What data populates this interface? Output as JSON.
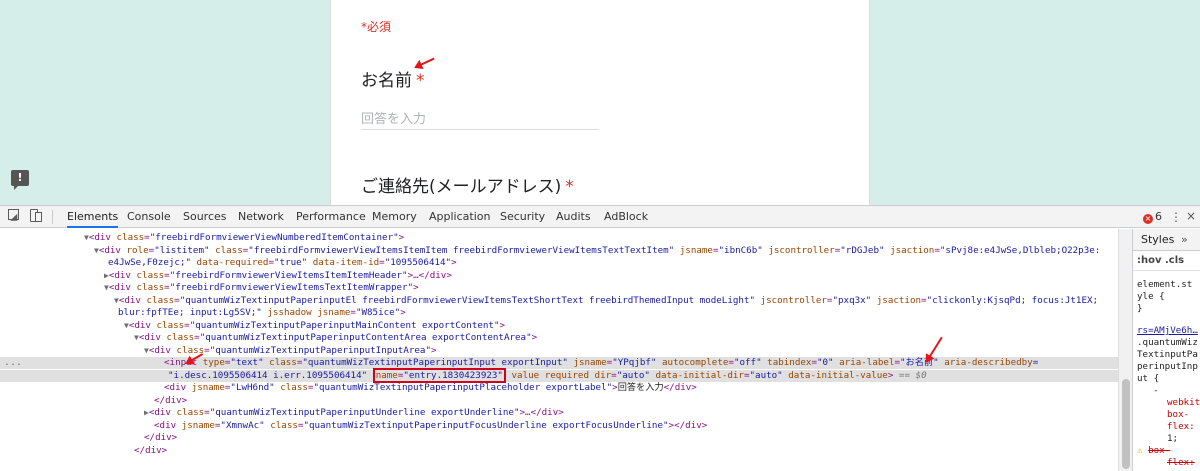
{
  "form": {
    "required_note": "*必須",
    "question1_title": "お名前",
    "question1_star": "*",
    "question1_placeholder": "回答を入力",
    "question2_title": "ご連絡先(メールアドレス)",
    "question2_star": "*",
    "feedback_icon_label": "!"
  },
  "devtools": {
    "tabs": [
      "Elements",
      "Console",
      "Sources",
      "Network",
      "Performance",
      "Memory",
      "Application",
      "Security",
      "Audits",
      "AdBlock"
    ],
    "active_tab": "Elements",
    "error_count": "6",
    "error_icon_label": "×",
    "more_label": "⋮",
    "close_label": "×",
    "dots_label": "...",
    "styles_title": "Styles",
    "styles_chevron": "»",
    "filter_label": ":hov .cls",
    "styles_lines": [
      "element.st",
      "yle {",
      "}",
      "rs=AMjVe6h…",
      ".quantumWiz",
      "TextinputPa",
      "perinputInp",
      "ut {",
      "-",
      "webkit-",
      "box-",
      "flex:",
      "1;",
      "box-",
      "flex:"
    ],
    "dom": {
      "l1": {
        "tag_open": "<div ",
        "a1n": "class",
        "a1v": "\"freebirdFormviewerViewNumberedItemContainer\"",
        "end": ">"
      },
      "l2": {
        "tag_open": "<div ",
        "a1n": "role",
        "a1v": "\"listitem\"",
        "a2n": "class",
        "a2v": "\"freebirdFormviewerViewItemsItemItem freebirdFormviewerViewItemsTextTextItem\"",
        "a3n": "jsname",
        "a3v": "\"ibnC6b\"",
        "a4n": "jscontroller",
        "a4v": "\"rDGJeb\"",
        "a5n": "jsaction",
        "a5v": "\"sPvj8e:e4JwSe,Dlbleb;O22p3e:"
      },
      "l3": {
        "text": "e4JwSe,F0zejc;\"",
        "a1n": "data-required",
        "a1v": "\"true\"",
        "a2n": "data-item-id",
        "a2v": "\"1095506414\"",
        "end": ">"
      },
      "l4": {
        "tag_open": "<div ",
        "a1n": "class",
        "a1v": "\"freebirdFormviewerViewItemsItemItemHeader\"",
        "mid": ">…",
        "close": "</div>"
      },
      "l5": {
        "tag_open": "<div ",
        "a1n": "class",
        "a1v": "\"freebirdFormviewerViewItemsTextItemWrapper\"",
        "end": ">"
      },
      "l6": {
        "tag_open": "<div ",
        "a1n": "class",
        "a1v": "\"quantumWizTextinputPaperinputEl freebirdFormviewerViewItemsTextShortText freebirdThemedInput modeLight\"",
        "a2n": "jscontroller",
        "a2v": "\"pxq3x\"",
        "a3n": "jsaction",
        "a3v": "\"clickonly:KjsqPd; focus:Jt1EX;"
      },
      "l7": {
        "text": "blur:fpfTEe; input:Lg5SV;\"",
        "a1n": "jsshadow",
        "a2n": "jsname",
        "a2v": "\"W85ice\"",
        "end": ">"
      },
      "l8": {
        "tag_open": "<div ",
        "a1n": "class",
        "a1v": "\"quantumWizTextinputPaperinputMainContent exportContent\"",
        "end": ">"
      },
      "l9": {
        "tag_open": "<div ",
        "a1n": "class",
        "a1v": "\"quantumWizTextinputPaperinputContentArea exportContentArea\"",
        "end": ">"
      },
      "l10": {
        "tag_open": "<div ",
        "a1n": "class",
        "a1v": "\"quantumWizTextinputPaperinputInputArea\"",
        "end": ">"
      },
      "l11": {
        "tag_open": "<input ",
        "a1n": "type",
        "a1v": "\"text\"",
        "a2n": "class",
        "a2v": "\"quantumWizTextinputPaperinputInput exportInput\"",
        "a3n": "jsname",
        "a3v": "\"YPqjbf\"",
        "a4n": "autocomplete",
        "a4v": "\"off\"",
        "a5n": "tabindex",
        "a5v": "\"0\"",
        "a6n": "aria-label",
        "a6v": "\"お名前\"",
        "a7n": "aria-describedby",
        "a7v": "="
      },
      "l12": {
        "text": "\"i.desc.1095506414 i.err.1095506414\"",
        "name_n": "name",
        "name_v": "\"entry.1830423923\"",
        "a1n": "value",
        "a2n": "required",
        "a3n": "dir",
        "a3v": "\"auto\"",
        "a4n": "data-initial-dir",
        "a4v": "\"auto\"",
        "a5n": "data-initial-value",
        "end": ">",
        "eq": "==",
        "dollar": "$0"
      },
      "l13": {
        "tag_open": "<div ",
        "a1n": "jsname",
        "a1v": "\"LwH6nd\"",
        "a2n": "class",
        "a2v": "\"quantumWizTextinputPaperinputPlaceholder exportLabel\"",
        "text": "回答を入力",
        "close": "</div>"
      },
      "l14": {
        "close": "</div>"
      },
      "l15": {
        "tag_open": "<div ",
        "a1n": "class",
        "a1v": "\"quantumWizTextinputPaperinputUnderline exportUnderline\"",
        "mid": ">…",
        "close": "</div>"
      },
      "l16": {
        "tag_open": "<div ",
        "a1n": "jsname",
        "a1v": "\"XmnwAc\"",
        "a2n": "class",
        "a2v": "\"quantumWizTextinputPaperinputFocusUnderline exportFocusUnderline\"",
        "mid": ">",
        "close": "</div>"
      },
      "l17": {
        "close": "</div>"
      },
      "l18": {
        "close": "</div>"
      }
    }
  }
}
